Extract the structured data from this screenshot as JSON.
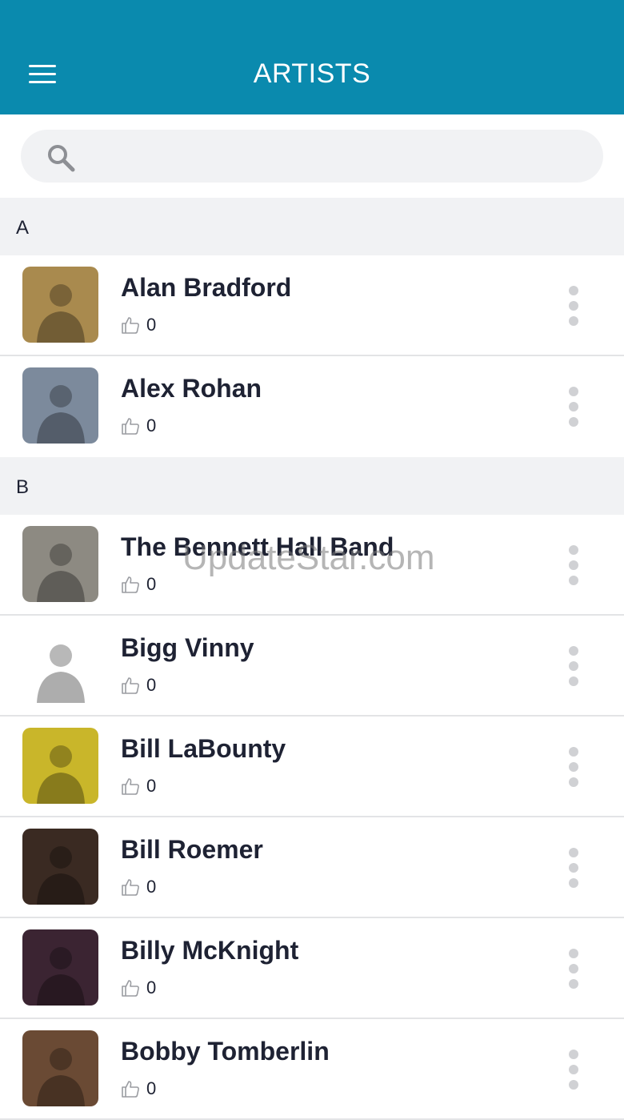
{
  "header": {
    "title": "ARTISTS",
    "menu_icon": "hamburger-menu-icon",
    "background_color": "#0a8aae"
  },
  "search": {
    "placeholder": "",
    "value": "",
    "icon": "search-icon"
  },
  "sections": [
    {
      "letter": "A",
      "artists": [
        {
          "name": "Alan Bradford",
          "likes": "0",
          "thumb_color": "#a98a4e"
        },
        {
          "name": "Alex Rohan",
          "likes": "0",
          "thumb_color": "#7c8a9c"
        }
      ]
    },
    {
      "letter": "B",
      "artists": [
        {
          "name": "The Bennett Hall Band",
          "likes": "0",
          "thumb_color": "#8d8a82"
        },
        {
          "name": "Bigg Vinny",
          "likes": "0",
          "thumb_color": "#ffffff"
        },
        {
          "name": "Bill LaBounty",
          "likes": "0",
          "thumb_color": "#c9b62a"
        },
        {
          "name": "Bill Roemer",
          "likes": "0",
          "thumb_color": "#3a2a22"
        },
        {
          "name": "Billy McKnight",
          "likes": "0",
          "thumb_color": "#3b2432"
        },
        {
          "name": "Bobby Tomberlin",
          "likes": "0",
          "thumb_color": "#6a4a34"
        }
      ]
    }
  ],
  "watermark": "UpdateStar.com"
}
